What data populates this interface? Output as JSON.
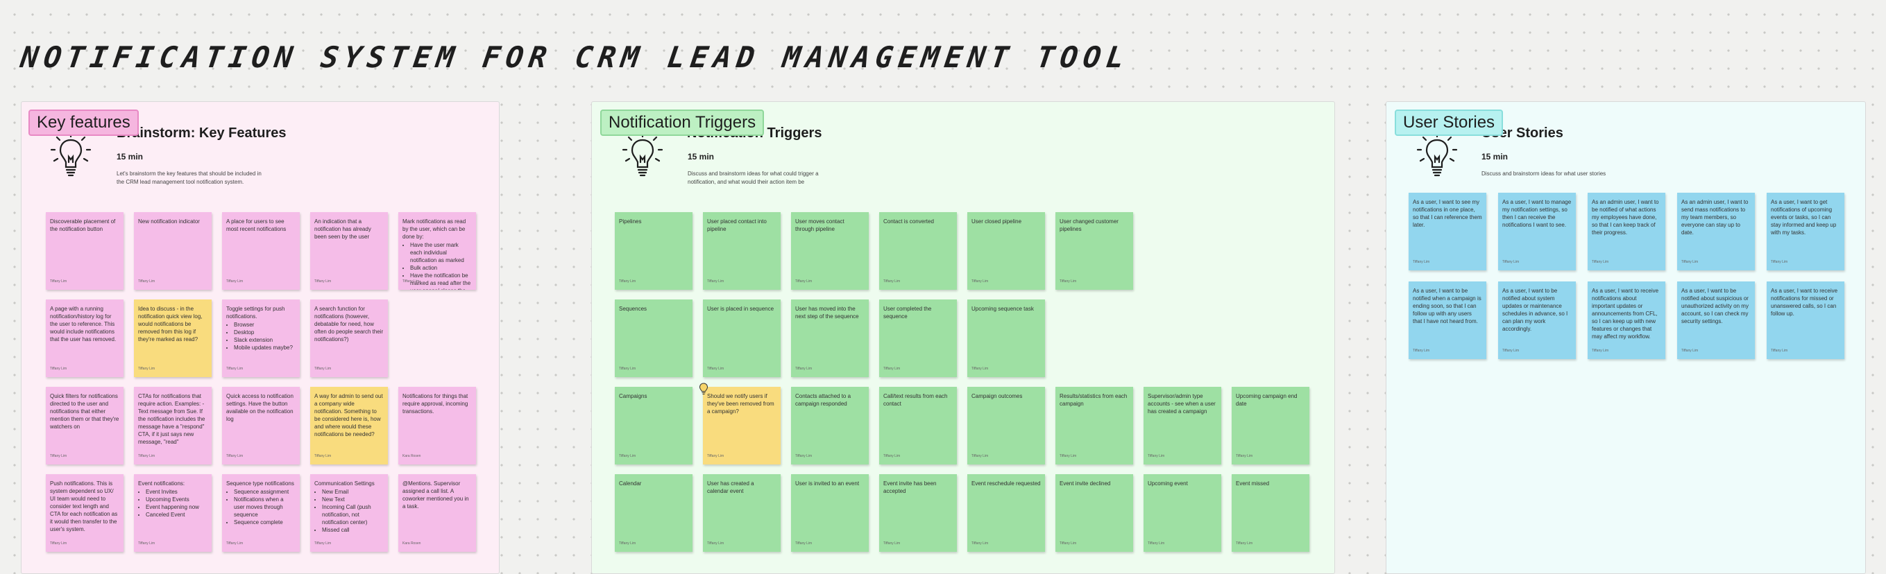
{
  "board": {
    "title": "NOTIFICATION SYSTEM FOR CRM LEAD MANAGEMENT TOOL"
  },
  "sections": {
    "key_features": {
      "tag": "Key features",
      "heading": "Brainstorm: Key Features",
      "duration": "15 min",
      "description": "Let's brainstorm the key features that should be included in the CRM lead management tool notification system.",
      "icon": "lightbulb-icon"
    },
    "triggers": {
      "tag": "Notification Triggers",
      "heading": "Notification Triggers",
      "duration": "15 min",
      "description": "Discuss and brainstorm ideas for what could trigger a notification, and what would their action item be",
      "icon": "lightbulb-icon"
    },
    "user_stories": {
      "tag": "User Stories",
      "heading": "User Stories",
      "duration": "15 min",
      "description": "Discuss and brainstorm ideas for what user stories",
      "icon": "lightbulb-icon"
    }
  },
  "colors": {
    "pink": "#f5bde8",
    "yellow": "#f9dc7e",
    "green": "#9ee0a3",
    "blue": "#92d6ee"
  },
  "notes": {
    "kf": [
      {
        "text": "Discoverable placement of the notification button",
        "author": "Tiffany Lim"
      },
      {
        "text": "New notification indicator",
        "author": "Tiffany Lim"
      },
      {
        "text": "A place for users to see most recent notifications",
        "author": "Tiffany Lim"
      },
      {
        "text": "An indication that a notification has already been seen by the user",
        "author": "Tiffany Lim"
      },
      {
        "text": "Mark notifications as read by the user, which can be done by:",
        "items": [
          "Have the user mark each individual notification as marked",
          "Bulk action",
          "Have the notification be marked as read after the user opens/ closes the notification log the first time (debatable for good UX)"
        ],
        "author": "Tiffany Lim"
      },
      {
        "text": "A page with a running notification/history log for the user to reference. This would include notifications that the user has removed.",
        "author": "Tiffany Lim"
      },
      {
        "text": "Idea to discuss - in the notification quick view log, would notifications be removed from this log if they're marked as read?",
        "author": "Tiffany Lim"
      },
      {
        "text": "Toggle settings for push notifications.",
        "items": [
          "Browser",
          "Desktop",
          "Slack extension",
          "Mobile updates maybe?"
        ],
        "author": "Tiffany Lim"
      },
      {
        "text": "A search function for notifications (however, debatable for need, how often do people search their notifications?)",
        "author": "Tiffany Lim"
      },
      {
        "text": "Quick filters for notifications directed to the user and notifications that either mention them or that they're watchers on",
        "author": "Tiffany Lim"
      },
      {
        "text": "CTAs for notifications that require action. Examples: - Text message from Sue. If the notification includes the message have a \"respond\" CTA, if it just says new message, \"read\"",
        "author": "Tiffany Lim"
      },
      {
        "text": "Quick access to notification settings. Have the button available on the notification log",
        "author": "Tiffany Lim"
      },
      {
        "text": "A way for admin to send out a company wide notification. Something to be considered here is, how and where would these notifications be needed?",
        "author": "Tiffany Lim"
      },
      {
        "text": "Notifications for things that require approval, incoming transactions.",
        "author": "Kara Rosen"
      },
      {
        "text": "Push notifications. This is system dependent so UX/ UI team would need to consider text length and CTA for each notification as it would then transfer to the user's system.",
        "author": "Tiffany Lim"
      },
      {
        "text": "Event notifications:",
        "items": [
          "Event Invites",
          "Upcoming Events",
          "Event happening now",
          "Canceled Event"
        ],
        "author": "Tiffany Lim"
      },
      {
        "text": "Sequence type notifications",
        "items": [
          "Sequence assignment",
          "Notifications when a user moves through sequence",
          "Sequence complete"
        ],
        "author": "Tiffany Lim"
      },
      {
        "text": "Communication Settings",
        "items": [
          "New Email",
          "New Text",
          "Incoming Call (push notification, not notification center)",
          "Missed call"
        ],
        "author": "Tiffany Lim"
      },
      {
        "text": "@Mentions. Supervisor assigned a call list. A coworker mentioned you in a task.",
        "author": "Kara Rosen"
      }
    ],
    "nt": [
      {
        "text": "Pipelines",
        "author": "Tiffany Lim"
      },
      {
        "text": "User placed contact into pipeline",
        "author": "Tiffany Lim"
      },
      {
        "text": "User moves contact through pipeline",
        "author": "Tiffany Lim"
      },
      {
        "text": "Contact is converted",
        "author": "Tiffany Lim"
      },
      {
        "text": "User closed pipeline",
        "author": "Tiffany Lim"
      },
      {
        "text": "User changed customer pipelines",
        "author": "Tiffany Lim"
      },
      {
        "text": "Sequences",
        "author": "Tiffany Lim"
      },
      {
        "text": "User is placed in sequence",
        "author": "Tiffany Lim"
      },
      {
        "text": "User has moved into the next step of the sequence",
        "author": "Tiffany Lim"
      },
      {
        "text": "User completed the sequence",
        "author": "Tiffany Lim"
      },
      {
        "text": "Upcoming sequence task",
        "author": "Tiffany Lim"
      },
      {
        "text": "Campaigns",
        "author": "Tiffany Lim"
      },
      {
        "text": "Should we notify users if they've been removed from a campaign?",
        "author": "Tiffany Lim"
      },
      {
        "text": "Contacts attached to a campaign responded",
        "author": "Tiffany Lim"
      },
      {
        "text": "Call/text results from each contact",
        "author": "Tiffany Lim"
      },
      {
        "text": "Campaign outcomes",
        "author": "Tiffany Lim"
      },
      {
        "text": "Results/statistics from each campaign",
        "author": "Tiffany Lim"
      },
      {
        "text": "Supervisor/admin type accounts - see when a user has created a campaign",
        "author": "Tiffany Lim"
      },
      {
        "text": "Upcoming campaign end date",
        "author": "Tiffany Lim"
      },
      {
        "text": "Calendar",
        "author": "Tiffany Lim"
      },
      {
        "text": "User has created a calendar event",
        "author": "Tiffany Lim"
      },
      {
        "text": "User is invited to an event",
        "author": "Tiffany Lim"
      },
      {
        "text": "Event invite has been accepted",
        "author": "Tiffany Lim"
      },
      {
        "text": "Event reschedule requested",
        "author": "Tiffany Lim"
      },
      {
        "text": "Event invite declined",
        "author": "Tiffany Lim"
      },
      {
        "text": "Upcoming event",
        "author": "Tiffany Lim"
      },
      {
        "text": "Event missed",
        "author": "Tiffany Lim"
      }
    ],
    "us": [
      {
        "text": "As a user, I want to see my notifications in one place, so that I can reference them later.",
        "author": "Tiffany Lim"
      },
      {
        "text": "As a user, I want to manage my notification settings, so then I can receive the notifications I want to see.",
        "author": "Tiffany Lim"
      },
      {
        "text": "As an admin user, I want to be notified of what actions my employees have done, so that I can keep track of their progress.",
        "author": "Tiffany Lim"
      },
      {
        "text": "As an admin user, I want to send mass notifications to my team members, so everyone can stay up to date.",
        "author": "Tiffany Lim"
      },
      {
        "text": "As a user, I want to get notifications of upcoming events or tasks, so I can stay informed and keep up with my tasks.",
        "author": "Tiffany Lim"
      },
      {
        "text": "As a user, I want to be notified when a campaign is ending soon, so that I can follow up with any users that I have not heard from.",
        "author": "Tiffany Lim"
      },
      {
        "text": "As a user, I want to be notified about system updates or maintenance schedules in advance, so I can plan my work accordingly.",
        "author": "Tiffany Lim"
      },
      {
        "text": "As a user, I want to receive notifications about important updates or announcements from CFL, so I can keep up with new features or changes that may affect my workflow.",
        "author": "Tiffany Lim"
      },
      {
        "text": "As a user, I want to be notified about suspicious or unauthorized activity on my account, so I can check my security settings.",
        "author": "Tiffany Lim"
      },
      {
        "text": "As a user, I want to receive notifications for missed or unanswered calls, so I can follow up.",
        "author": "Tiffany Lim"
      }
    ]
  }
}
